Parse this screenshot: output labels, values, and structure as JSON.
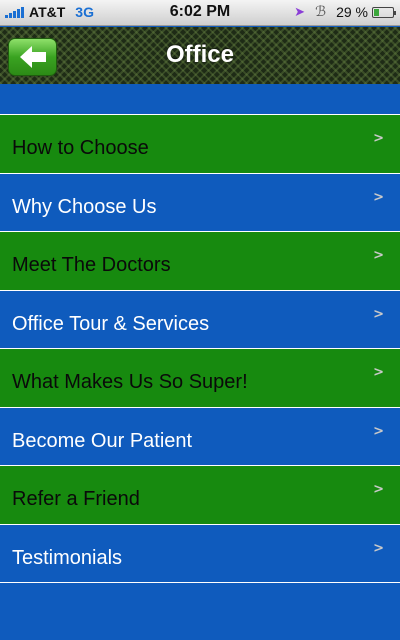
{
  "status_bar": {
    "carrier": "AT&T",
    "network": "3G",
    "time": "6:02 PM",
    "battery_percent": "29 %",
    "battery_level": 0.29
  },
  "nav": {
    "title": "Office",
    "back_icon": "arrow-left-icon"
  },
  "colors": {
    "green_row": "#178a0f",
    "blue_row": "#0f5bbd",
    "back_button": "#3aa321"
  },
  "menu": {
    "items": [
      {
        "label": "How to Choose"
      },
      {
        "label": "Why Choose Us"
      },
      {
        "label": "Meet The Doctors"
      },
      {
        "label": "Office Tour & Services"
      },
      {
        "label": "What Makes Us So Super!"
      },
      {
        "label": "Become Our Patient"
      },
      {
        "label": "Refer a Friend"
      },
      {
        "label": "Testimonials"
      }
    ]
  }
}
